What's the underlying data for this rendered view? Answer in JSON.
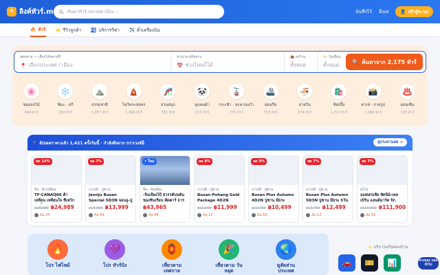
{
  "brand": {
    "logo_text": "ลิงค์ทัวร์.me",
    "accent": "#ffb020",
    "primary": "#2563eb",
    "cta": "#f05a1a"
  },
  "header": {
    "search_placeholder": "ค้นหาทัวร์ ประเทศ เมือง...",
    "links": [
      "บันทึกไว้",
      "อีเมล",
      "เข้าสู่ระบบ"
    ]
  },
  "nav": {
    "tabs": [
      "ทัวร์",
      "รีวิวลูกค้า",
      "บริการวีซ่า",
      "ตั๋วเครื่องบิน"
    ],
    "active": 0
  },
  "search": {
    "destination_label": "จุดหมาย — เลือกได้หลายที่",
    "destination_placeholder": "เลือกประเทศ / เมือง",
    "date_label": "ช่วงเวลาเดินทาง",
    "date_placeholder": "ช่วงไหนก็ได้",
    "budget_label": "ลงร้าน",
    "budget_value": "ทั้งหมด",
    "days_label": "วันเดือน",
    "days_value": "ทั้งหมด",
    "button_label": "ค้นหาจาก 2,175 ทัวร์"
  },
  "categories": [
    {
      "name": "ชมดอกไม้",
      "count": "449 ทัวร์",
      "icon": "🌸"
    },
    {
      "name": "หิมะ - สกี",
      "count": "250 ทัวร์",
      "icon": "❄️"
    },
    {
      "name": "ธรรมชาติ",
      "count": "1,357 ทัวร์",
      "icon": "⛰️"
    },
    {
      "name": "ไหว้พระขอพร",
      "count": "1,356 ทัวร์",
      "icon": "🛕"
    },
    {
      "name": "สวนสนุก",
      "count": "381 ทัวร์",
      "icon": "🎢"
    },
    {
      "name": "ดูแพนด้า",
      "count": "215 ทัวร์",
      "icon": "🐼"
    },
    {
      "name": "กระเช้า - สะพานแก้ว",
      "count": "733 ทัวร์",
      "icon": "🚡"
    },
    {
      "name": "ล่องเรือ",
      "count": "713 ทัวร์",
      "icon": "🚢"
    },
    {
      "name": "สายกิน",
      "count": "574 ทัวร์",
      "icon": "🍜"
    },
    {
      "name": "ช้อปปิ้ง",
      "count": "1,712 ทัวร์",
      "icon": "🛍️"
    },
    {
      "name": "คาเฟ่ - ถ่ายรูป",
      "count": "1,084 ทัวร์",
      "icon": "📸"
    },
    {
      "name": "ออนเซ็น",
      "count": "235 ทัวร์",
      "icon": "♨️"
    }
  ],
  "deals": {
    "header_text": "อัปเดตราคาแล้ว 1,421 ครั้งวันนี้ · กำลังดึงจาก กราเวงซ์อ็",
    "more_label": "ดูกระดานลด →",
    "cards": [
      {
        "badge": "ลด 14%",
        "sub": "จีน · ต้าเหลียน",
        "title": "TF-CANAQ06 ต้าเหลียน เหลียนใจ ซีเหวิก ท่าเรือ",
        "old": "฿28,989",
        "price": "฿24,989",
        "foot": "อัน 25",
        "photo": false
      },
      {
        "badge": "ลด 7%",
        "sub": "เกาหลี · ปูซาน",
        "title": "Jeonju Busan Special 5D3N จอนจู-ปูซาน",
        "old": "฿14,999",
        "price": "฿13,999",
        "foot": "อัน 54",
        "photo": false
      },
      {
        "badge": "• ใหม่",
        "sub": "จีน · จินเจียง",
        "title": "-จิ่นเจียงไป้ สวรรค์บนดิน ชองชินเรียบ คัดคาร์ ธาร",
        "old": "",
        "price": "฿43,965",
        "foot": "อัน 44",
        "photo": true
      },
      {
        "badge": "ลด 8%",
        "sub": "เกาหลี · ปูซาน",
        "title": "Busan Pohang Gold Package 4D2N",
        "old": "฿12,999",
        "price": "฿11,999",
        "foot": "อัน 12",
        "photo": false
      },
      {
        "badge": "ลด 9%",
        "sub": "เกาหลี · ปูซาน",
        "title": "Busan Plus Autumn 4D2N ปูซาน มีธระ",
        "old": "฿11,499",
        "price": "฿10,499",
        "foot": "อัน 50",
        "photo": false
      },
      {
        "badge": "ลด 7%",
        "sub": "เกาหลี · ปูซาน",
        "title": "Busan Plus Autumn 5D3N ปูซาน มีธระ 5วัน",
        "old": "฿13,499",
        "price": "฿12,499",
        "foot": "อัน 12",
        "photo": false
      },
      {
        "badge": "ลด 7%",
        "sub": "ยุโรป",
        "title": "ออสเตรเลีย ซิดนีย์-เพลเบิร์น แลนด์มาร์ค บิก",
        "old": "฿119,900",
        "price": "฿111,900",
        "foot": "อัน 50",
        "photo": false
      }
    ]
  },
  "promo": [
    {
      "label": "โปร ไฟไหม้",
      "icon": "🔥",
      "color": "#ff6b3d"
    },
    {
      "label": "โปร ทัวร์ปัง",
      "icon": "💜",
      "color": "#9b5de5"
    },
    {
      "label": "เที่ยวตาม เทศกาล",
      "icon": "🏮",
      "color": "#ff8a00"
    },
    {
      "label": "เที่ยวตาม วันหยุด",
      "icon": "🎉",
      "color": "#22b573"
    },
    {
      "label": "ดูสัดส่วน ประเทศ",
      "icon": "🌏",
      "color": "#2f80ed"
    }
  ],
  "services": {
    "title": "✨ บริการเสริมของร้าน",
    "items": [
      {
        "icon": "🚗",
        "color": "#2563eb"
      },
      {
        "icon": "🎫",
        "color": "#111827"
      },
      {
        "icon": "📊",
        "color": "#059669"
      }
    ]
  },
  "chat": {
    "label": "ทางนอก ถอนทั่วไป"
  }
}
